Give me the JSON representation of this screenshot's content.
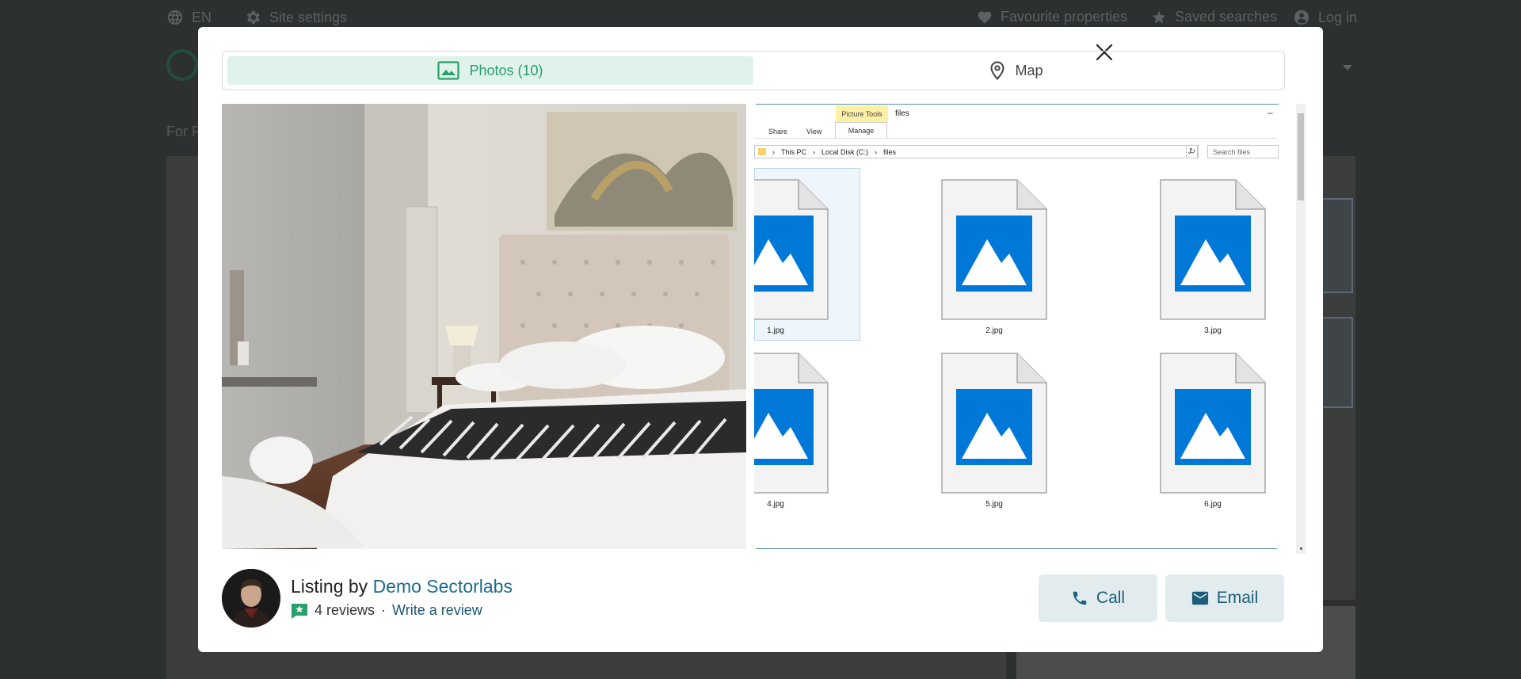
{
  "topbar": {
    "language": "EN",
    "site_settings": "Site settings",
    "favourites": "Favourite properties",
    "saved_searches": "Saved searches",
    "login": "Log in"
  },
  "background": {
    "breadcrumb": "For R"
  },
  "gallery": {
    "tabs": [
      {
        "label": "Photos (10)",
        "icon": "image-icon",
        "active": true
      },
      {
        "label": "Map",
        "icon": "map-pin-icon",
        "active": false
      }
    ],
    "explorer": {
      "ribbon_group": "Picture Tools",
      "window_title": "files",
      "ribbon_tabs": [
        "Share",
        "View",
        "Manage"
      ],
      "path": [
        "This PC",
        "Local Disk (C:)",
        "files"
      ],
      "search_placeholder": "Search files",
      "files": [
        "1.jpg",
        "2.jpg",
        "3.jpg",
        "4.jpg",
        "5.jpg",
        "6.jpg"
      ]
    }
  },
  "agent": {
    "listing_by_prefix": "Listing by ",
    "name": "Demo Sectorlabs",
    "reviews_count": "4",
    "reviews_label": "reviews",
    "separator": "·",
    "write_review": "Write a review"
  },
  "actions": {
    "call": "Call",
    "email": "Email"
  },
  "colors": {
    "accent_green": "#28a06b",
    "tab_active_bg": "#dff3eb",
    "link_blue": "#1d6c8a",
    "button_bg": "#e2ecee",
    "overlay": "#2d3030",
    "file_icon_blue": "#0078d7"
  }
}
